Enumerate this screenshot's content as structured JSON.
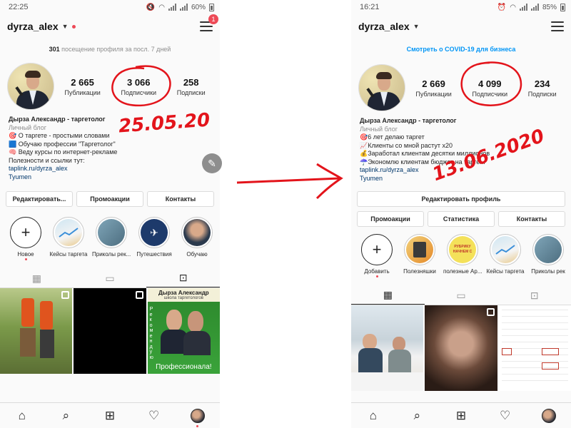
{
  "left_phone": {
    "status": {
      "time": "22:25",
      "battery": "60%"
    },
    "username": "dyrza_alex",
    "menu_badge": "1",
    "visits": {
      "count": "301",
      "text": " посещение профиля за посл. 7 дней"
    },
    "stats": [
      {
        "num": "2 665",
        "label": "Публикации"
      },
      {
        "num": "3 066",
        "label": "Подписчики"
      },
      {
        "num": "258",
        "label": "Подписки"
      }
    ],
    "bio": {
      "name": "Дырза Александр - таргетолог",
      "category": "Личный блог",
      "lines": [
        "🎯 О таргете - простыми словами",
        "🟦 Обучаю профессии \"Таргетолог\"",
        "🧠 Веду курсы по интернет-рекламе",
        "Полезности и ссылки тут:"
      ],
      "link": "taplink.ru/dyrza_alex",
      "location": "Tyumen"
    },
    "buttons": [
      "Редактировать...",
      "Промоакции",
      "Контакты"
    ],
    "stories": [
      "Новое",
      "Кейсы таргета",
      "Приколы рек...",
      "Путешествия",
      "Обучаю"
    ],
    "post_text": {
      "top": "Дырза Александр",
      "sub": "школа таргетологов",
      "vertical": "Рекомендую",
      "bottom": "Профессионала!"
    },
    "annotation_date": "25.05.20"
  },
  "right_phone": {
    "status": {
      "time": "16:21",
      "battery": "85%"
    },
    "username": "dyrza_alex",
    "covid_link": "Смотреть о COVID-19 для бизнеса",
    "stats": [
      {
        "num": "2 669",
        "label": "Публикации"
      },
      {
        "num": "4 099",
        "label": "Подписчики"
      },
      {
        "num": "234",
        "label": "Подписки"
      }
    ],
    "bio": {
      "name": "Дырза Александр - таргетолог",
      "category": "Личный блог",
      "lines": [
        "🎯6 лет делаю таргет",
        "📈Клиенты со мной растут х20",
        "💰Заработал клиентам десятки миллионов",
        "☂️Экономлю клиентам бюджет на тарге..."
      ],
      "link": "taplink.ru/dyrza_alex",
      "location": "Tyumen"
    },
    "edit_profile": "Редактировать профиль",
    "buttons": [
      "Промоакции",
      "Статистика",
      "Контакты"
    ],
    "stories": [
      "Добавить",
      "Полезняшки",
      "полезные Ар...",
      "Кейсы таргета",
      "Приколы рек"
    ],
    "story_texts": {
      "rubric": "РУБРИКУ",
      "start": "НАЧНЕМ С"
    },
    "annotation_date": "13.06.2020"
  },
  "colors": {
    "accent_red": "#e3141b",
    "link_blue": "#0095f6",
    "badge_red": "#ed4956"
  }
}
